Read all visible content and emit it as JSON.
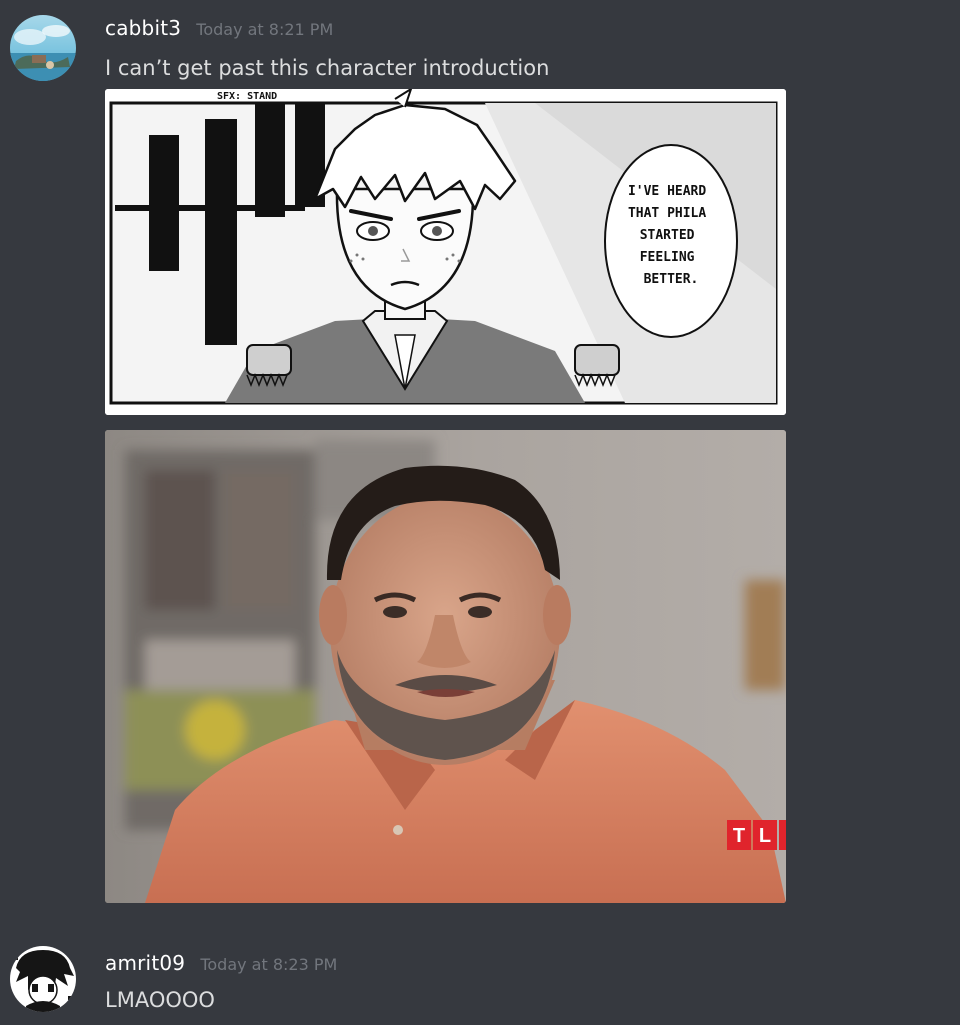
{
  "messages": [
    {
      "username": "cabbit3",
      "timestamp": "Today at 8:21 PM",
      "text": "I can’t get past this character introduction",
      "attachments": [
        {
          "kind": "manga-panel",
          "sfx": "SFX: STAND",
          "speech_bubble": [
            "I'VE HEARD",
            "THAT PHILA",
            "STARTED",
            "FEELING",
            "BETTER."
          ]
        },
        {
          "kind": "photo",
          "watermark": "TL"
        }
      ]
    },
    {
      "username": "amrit09",
      "timestamp": "Today at 8:23 PM",
      "text": "LMAOOOO"
    }
  ],
  "colors": {
    "background": "#36393f",
    "username": "#ffffff",
    "timestamp": "#72767d",
    "message_text": "#dcddde",
    "watermark_red": "#e0242c"
  }
}
